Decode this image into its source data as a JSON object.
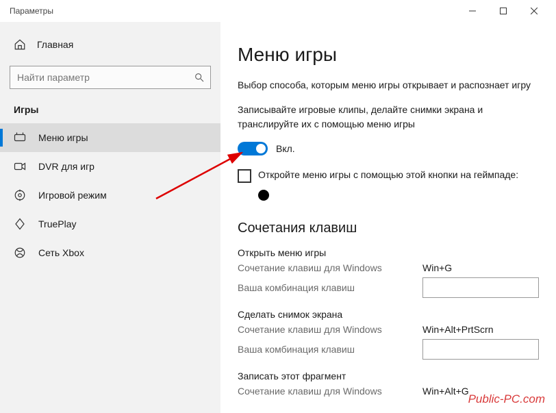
{
  "window": {
    "title": "Параметры"
  },
  "sidebar": {
    "home": "Главная",
    "search_placeholder": "Найти параметр",
    "section": "Игры",
    "items": [
      {
        "label": "Меню игры",
        "selected": true
      },
      {
        "label": "DVR для игр"
      },
      {
        "label": "Игровой режим"
      },
      {
        "label": "TruePlay"
      },
      {
        "label": "Сеть Xbox"
      }
    ]
  },
  "main": {
    "title": "Меню игры",
    "desc1": "Выбор способа, которым меню игры открывает и распознает игру",
    "desc2": "Записывайте игровые клипы, делайте снимки экрана и транслируйте их с помощью меню игры",
    "toggle_state": "Вкл.",
    "checkbox_label": "Откройте меню игры с помощью этой кнопки на геймпаде:",
    "shortcuts_title": "Сочетания клавиш",
    "groups": [
      {
        "title": "Открыть меню игры",
        "win_label": "Сочетание клавиш для Windows",
        "win_value": "Win+G",
        "user_label": "Ваша комбинация клавиш"
      },
      {
        "title": "Сделать снимок экрана",
        "win_label": "Сочетание клавиш для Windows",
        "win_value": "Win+Alt+PrtScrn",
        "user_label": "Ваша комбинация клавиш"
      },
      {
        "title": "Записать этот фрагмент",
        "win_label": "Сочетание клавиш для Windows",
        "win_value": "Win+Alt+G"
      }
    ]
  },
  "watermark": "Public-PC.com"
}
